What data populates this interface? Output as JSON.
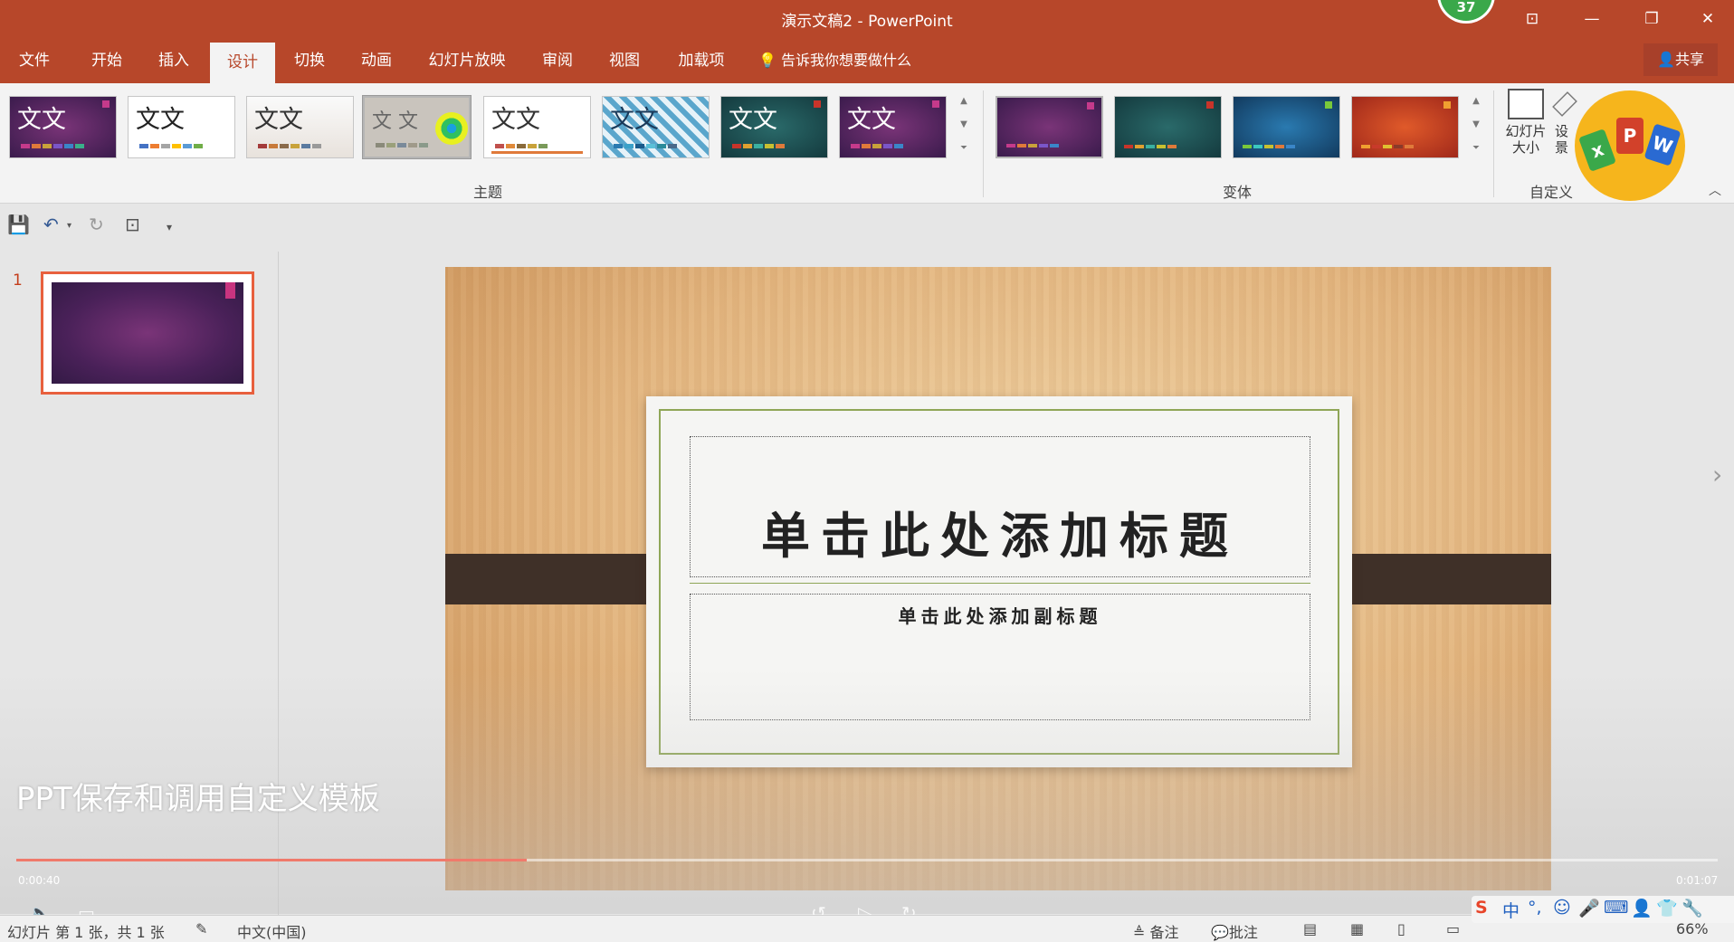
{
  "window": {
    "title": "演示文稿2  -  PowerPoint",
    "notification_count": "37",
    "buttons": {
      "ribbon_display": "⊡",
      "minimize": "—",
      "restore": "❐",
      "close": "✕"
    }
  },
  "ribbon": {
    "tabs": [
      "文件",
      "开始",
      "插入",
      "设计",
      "切换",
      "动画",
      "幻灯片放映",
      "审阅",
      "视图",
      "加载项"
    ],
    "active_tab": "设计",
    "tell_me": "告诉我你想要做什么",
    "share": "共享",
    "themes_label": "主题",
    "variants_label": "变体",
    "customize_label": "自定义",
    "theme_sample_text": "文文",
    "theme_sample_text_spaced": "文 文",
    "slide_size_label_1": "幻灯片",
    "slide_size_label_2": "大小",
    "format_bg_label_1": "设",
    "format_bg_label_2": "景"
  },
  "slides_pane": {
    "slide_number": "1"
  },
  "slide": {
    "title_placeholder": "单击此处添加标题",
    "subtitle_placeholder": "单击此处添加副标题"
  },
  "video": {
    "caption": "PPT保存和调用自定义模板",
    "time_current": "0:00:40",
    "time_total": "0:01:07",
    "progress_fraction": 0.3
  },
  "statusbar": {
    "slide_info": "幻灯片 第 1 张，共 1 张",
    "language": "中文(中国)",
    "notes": "备注",
    "comments": "批注",
    "zoom": "66%"
  },
  "ime": {
    "mode": "中"
  },
  "colors": {
    "accent": "#b7472a",
    "selected_thumb_border": "#e8603e"
  }
}
